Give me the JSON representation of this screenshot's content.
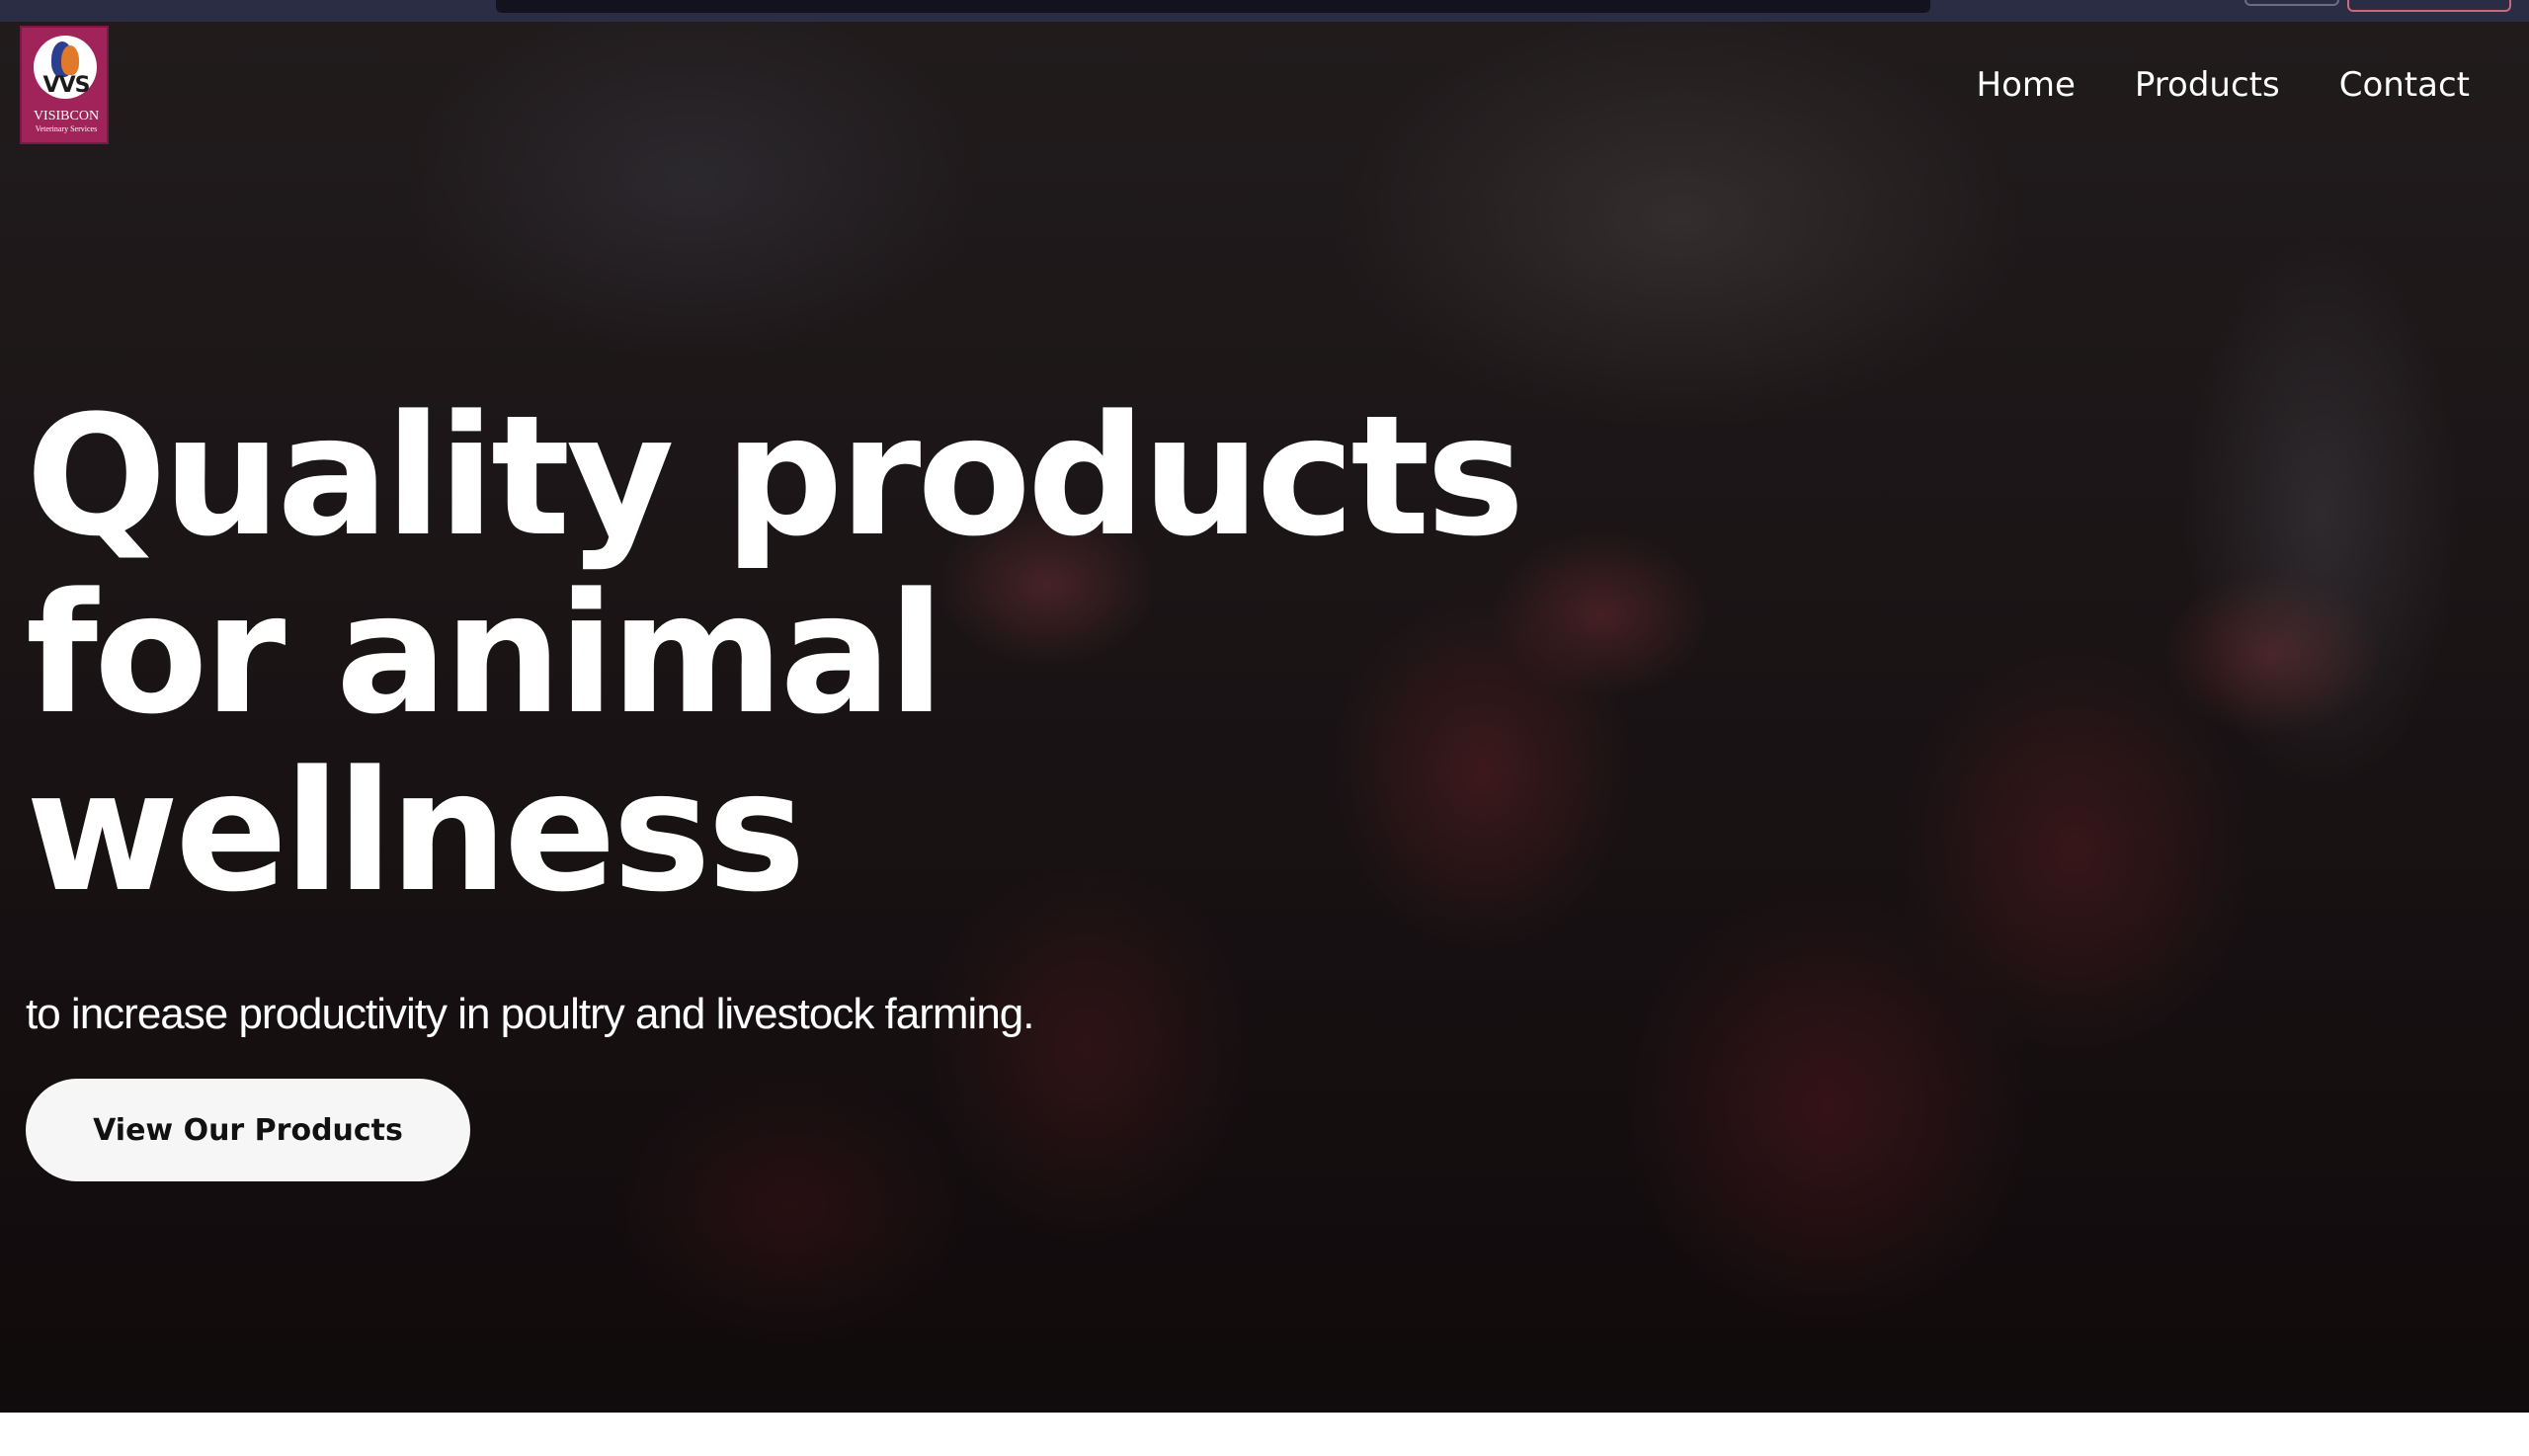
{
  "logo": {
    "mark": "VVS",
    "name": "VISIBCON",
    "tagline": "Veterinary Services",
    "brand_color": "#a0245a"
  },
  "nav": {
    "items": [
      {
        "label": "Home"
      },
      {
        "label": "Products"
      },
      {
        "label": "Contact"
      }
    ]
  },
  "hero": {
    "headline": "Quality products for animal wellness",
    "subtitle": "to increase productivity in poultry and livestock farming.",
    "cta_label": "View Our Products"
  }
}
